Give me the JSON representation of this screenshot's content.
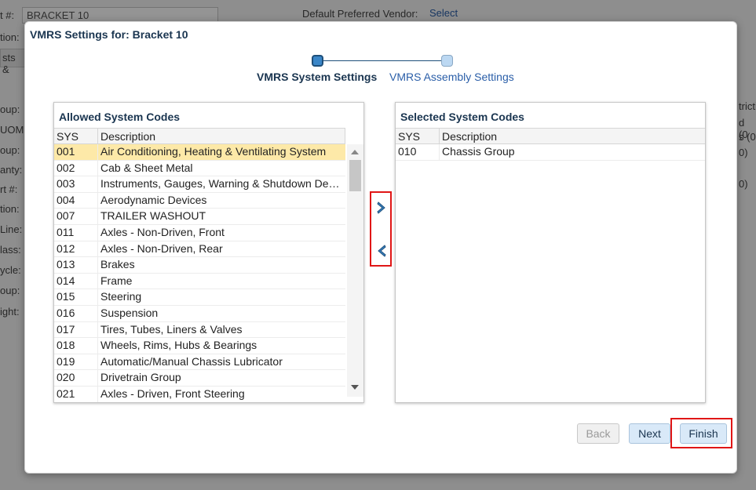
{
  "background": {
    "part_label": "t #:",
    "part_value": "BRACKET 10",
    "description_label": "tion:",
    "tab_label": "sts &",
    "vendor_label": "Default Preferred Vendor:",
    "vendor_link": "Select",
    "left_labels": [
      "oup:",
      "UOM:",
      "oup:",
      "anty:",
      "rt #:",
      "tion:",
      "Line:",
      "lass:",
      "ycle:",
      "oup:",
      "ight:"
    ],
    "right_labels": [
      "tricti",
      "d (0",
      "s (0",
      "0)",
      "0)"
    ]
  },
  "modal": {
    "title": "VMRS Settings for: Bracket 10",
    "steps": [
      {
        "label": "VMRS System Settings",
        "active": true
      },
      {
        "label": "VMRS Assembly Settings",
        "active": false
      }
    ],
    "allowed": {
      "title": "Allowed System Codes",
      "columns": [
        "SYS",
        "Description"
      ],
      "rows": [
        {
          "sys": "001",
          "desc": "Air Conditioning, Heating & Ventilating System"
        },
        {
          "sys": "002",
          "desc": "Cab & Sheet Metal"
        },
        {
          "sys": "003",
          "desc": "Instruments, Gauges, Warning & Shutdown Devi..."
        },
        {
          "sys": "004",
          "desc": "Aerodynamic Devices"
        },
        {
          "sys": "007",
          "desc": "TRAILER WASHOUT"
        },
        {
          "sys": "011",
          "desc": "Axles - Non-Driven, Front"
        },
        {
          "sys": "012",
          "desc": "Axles - Non-Driven, Rear"
        },
        {
          "sys": "013",
          "desc": "Brakes"
        },
        {
          "sys": "014",
          "desc": "Frame"
        },
        {
          "sys": "015",
          "desc": "Steering"
        },
        {
          "sys": "016",
          "desc": "Suspension"
        },
        {
          "sys": "017",
          "desc": "Tires, Tubes, Liners & Valves"
        },
        {
          "sys": "018",
          "desc": "Wheels, Rims, Hubs & Bearings"
        },
        {
          "sys": "019",
          "desc": "Automatic/Manual Chassis Lubricator"
        },
        {
          "sys": "020",
          "desc": "Drivetrain Group"
        },
        {
          "sys": "021",
          "desc": "Axles - Driven, Front Steering"
        }
      ]
    },
    "selected": {
      "title": "Selected System Codes",
      "columns": [
        "SYS",
        "Description"
      ],
      "rows": [
        {
          "sys": "010",
          "desc": "Chassis Group"
        }
      ]
    },
    "move_right_icon": "chevron-right-icon",
    "move_left_icon": "chevron-left-icon",
    "buttons": {
      "back": "Back",
      "next": "Next",
      "finish": "Finish"
    },
    "accent_color": "#1a3550",
    "highlight_color": "#e01616"
  }
}
